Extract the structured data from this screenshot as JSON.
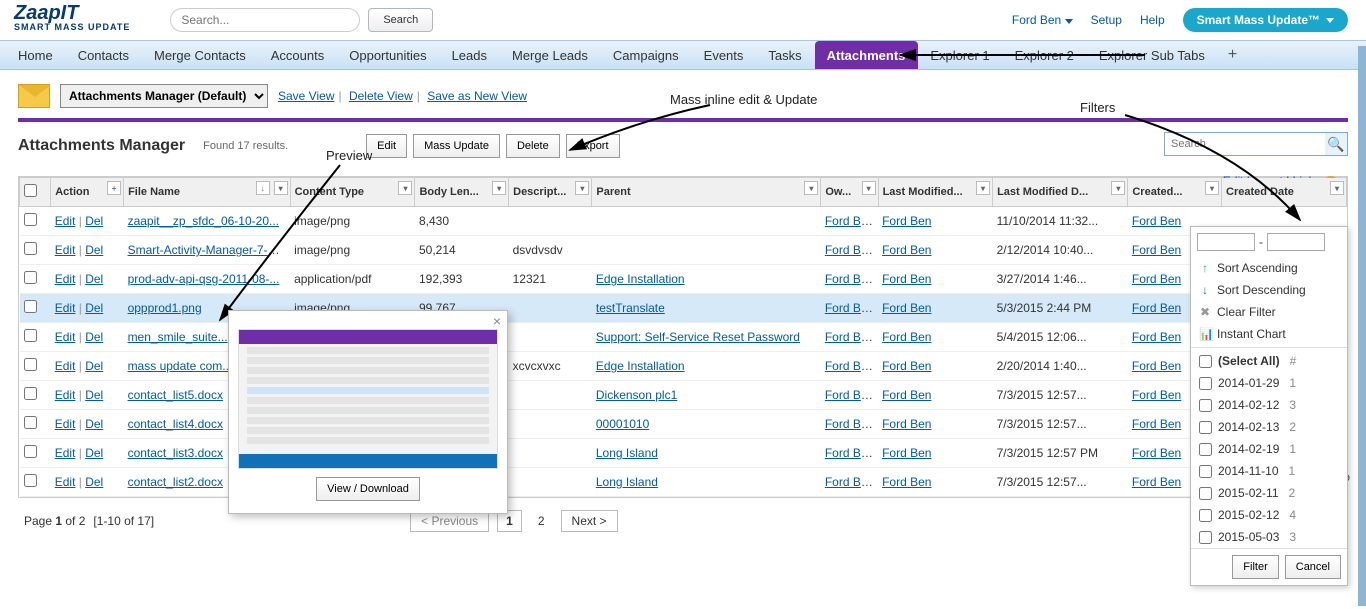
{
  "top": {
    "logo_main": "ZaapIT",
    "logo_sub": "SMART MASS UPDATE",
    "search_placeholder": "Search...",
    "search_btn": "Search",
    "user": "Ford Ben",
    "setup": "Setup",
    "help": "Help",
    "smu_btn": "Smart Mass Update™"
  },
  "nav": {
    "tabs": [
      "Home",
      "Contacts",
      "Merge Contacts",
      "Accounts",
      "Opportunities",
      "Leads",
      "Merge Leads",
      "Campaigns",
      "Events",
      "Tasks",
      "Attachments",
      "Explorer 1",
      "Explorer 2",
      "Explorer Sub Tabs"
    ],
    "active_index": 10
  },
  "view": {
    "select_label": "Attachments Manager (Default)",
    "save": "Save View",
    "delete": "Delete View",
    "saveas": "Save as New View",
    "edit_layout": "Edit Layout",
    "links": "Links"
  },
  "mgr": {
    "title": "Attachments Manager",
    "results": "Found 17 results.",
    "buttons": [
      "Edit",
      "Mass Update",
      "Delete",
      "Export"
    ],
    "grid_search_placeholder": "Search"
  },
  "annotations": {
    "preview": "Preview",
    "mass": "Mass inline edit & Update",
    "filters": "Filters"
  },
  "cols": [
    "",
    "Action",
    "File Name",
    "Content Type",
    "Body Len...",
    "Descript...",
    "Parent",
    "Ow...",
    "Last Modified...",
    "Last Modified D...",
    "Created...",
    "Created Date"
  ],
  "rows": [
    {
      "file": "zaapit__zp_sfdc_06-10-20...",
      "ct": "image/png",
      "len": "8,430",
      "desc": "",
      "parent": "",
      "own": "Ford Ben",
      "lmb": "Ford Ben",
      "lmd": "11/10/2014 11:32...",
      "cb": "Ford Ben",
      "cd": ""
    },
    {
      "file": "Smart-Activity-Manager-7-all...",
      "ct": "image/png",
      "len": "50,214",
      "desc": "dsvdvsdv",
      "parent": "",
      "own": "Ford Ben",
      "lmb": "Ford Ben",
      "lmd": "2/12/2014 10:40...",
      "cb": "Ford Ben",
      "cd": ""
    },
    {
      "file": "prod-adv-api-qsg-2011-08-...",
      "ct": "application/pdf",
      "len": "192,393",
      "desc": "12321",
      "parent": "Edge Installation",
      "own": "Ford Ben",
      "lmb": "Ford Ben",
      "lmd": "3/27/2014 1:46...",
      "cb": "Ford Ben",
      "cd": ""
    },
    {
      "file": "oppprod1.png",
      "ct": "image/png",
      "len": "99,767",
      "desc": "",
      "parent": "testTranslate",
      "own": "Ford Ben",
      "lmb": "Ford Ben",
      "lmd": "5/3/2015 2:44 PM",
      "cb": "Ford Ben",
      "cd": ""
    },
    {
      "file": "men_smile_suite...",
      "ct": "",
      "len": "",
      "desc": "",
      "parent": "Support: Self-Service Reset Password",
      "own": "Ford Ben",
      "lmb": "Ford Ben",
      "lmd": "5/4/2015 12:06...",
      "cb": "Ford Ben",
      "cd": ""
    },
    {
      "file": "mass update com...",
      "ct": "",
      "len": "",
      "desc": "xcvcxvxc",
      "parent": "Edge Installation",
      "own": "Ford Ben",
      "lmb": "Ford Ben",
      "lmd": "2/20/2014 1:40...",
      "cb": "Ford Ben",
      "cd": ""
    },
    {
      "file": "contact_list5.docx",
      "ct": "",
      "len": "",
      "desc": "",
      "parent": "Dickenson plc1",
      "own": "Ford Ben",
      "lmb": "Ford Ben",
      "lmd": "7/3/2015 12:57...",
      "cb": "Ford Ben",
      "cd": ""
    },
    {
      "file": "contact_list4.docx",
      "ct": "",
      "len": "",
      "desc": "",
      "parent": "00001010",
      "own": "Ford Ben",
      "lmb": "Ford Ben",
      "lmd": "7/3/2015 12:57...",
      "cb": "Ford Ben",
      "cd": ""
    },
    {
      "file": "contact_list3.docx",
      "ct": "",
      "len": "",
      "desc": "",
      "parent": "Long Island",
      "own": "Ford Ben",
      "lmb": "Ford Ben",
      "lmd": "7/3/2015 12:57 PM",
      "cb": "Ford Ben",
      "cd": ""
    },
    {
      "file": "contact_list2.docx",
      "ct": "",
      "len": "",
      "desc": "",
      "parent": "Long Island",
      "own": "Ford Ben",
      "lmb": "Ford Ben",
      "lmd": "7/3/2015 12:57...",
      "cb": "Ford Ben",
      "cd": ""
    }
  ],
  "action": {
    "edit": "Edit",
    "del": "Del"
  },
  "pager": {
    "label": "Page ",
    "cur": "1",
    "of_total": " of 2",
    "range": "[1-10 of 17]",
    "prev": "< Previous",
    "p1": "1",
    "p2": "2",
    "next": "Next >",
    "rows": "Ro"
  },
  "preview": {
    "view_dl": "View / Download"
  },
  "filter": {
    "sort_asc": "Sort Ascending",
    "sort_desc": "Sort Descending",
    "clear": "Clear Filter",
    "chart": "Instant Chart",
    "select_all": "(Select All)",
    "select_all_cnt": "#",
    "opts": [
      {
        "v": "2014-01-29",
        "c": "1"
      },
      {
        "v": "2014-02-12",
        "c": "3"
      },
      {
        "v": "2014-02-13",
        "c": "2"
      },
      {
        "v": "2014-02-19",
        "c": "1"
      },
      {
        "v": "2014-11-10",
        "c": "1"
      },
      {
        "v": "2015-02-11",
        "c": "2"
      },
      {
        "v": "2015-02-12",
        "c": "4"
      },
      {
        "v": "2015-05-03",
        "c": "3"
      }
    ],
    "filter_btn": "Filter",
    "cancel_btn": "Cancel"
  }
}
